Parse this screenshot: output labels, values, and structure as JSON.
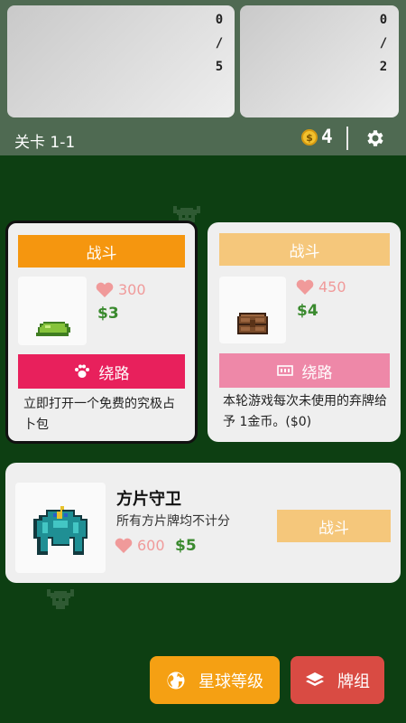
{
  "header": {
    "panel_left": {
      "digit_top": "0",
      "digit_sep": "/",
      "digit_bottom": "5"
    },
    "panel_right": {
      "digit_top": "0",
      "digit_sep": "/",
      "digit_bottom": "2"
    },
    "level": "关卡 1-1",
    "coin_symbol": "$",
    "coins": "4",
    "settings_icon": "gear-icon"
  },
  "cards": {
    "left": {
      "fight_label": "战斗",
      "hp": "300",
      "reward": "$3",
      "skip_label": "绕路",
      "skip_icon": "paw-icon",
      "description": "立即打开一个免费的究极占卜包",
      "image_icon": "green-slime"
    },
    "right": {
      "fight_label": "战斗",
      "hp": "450",
      "reward": "$4",
      "skip_label": "绕路",
      "skip_icon": "ticket-icon",
      "description": "本轮游戏每次未使用的弃牌给予 1金币。($0)",
      "image_icon": "treasure-chest"
    },
    "boss": {
      "title": "方片守卫",
      "subtitle": "所有方片牌均不计分",
      "hp": "600",
      "reward": "$5",
      "fight_label": "战斗",
      "image_icon": "teal-golem"
    }
  },
  "bottom": {
    "planet_label": "星球等级",
    "planet_icon": "globe-icon",
    "deck_label": "牌组",
    "deck_icon": "layers-icon"
  },
  "colors": {
    "background": "#0d3f12",
    "header": "#4f6a52",
    "fight_active": "#f5960f",
    "fight_inactive": "#f5c77b",
    "skip_active": "#e8205c",
    "skip_inactive": "#ee88a8",
    "heart_active": "#f09a9a",
    "money_green": "#3a8a2e",
    "planet_button": "#f5a013",
    "deck_button": "#d94b43"
  }
}
